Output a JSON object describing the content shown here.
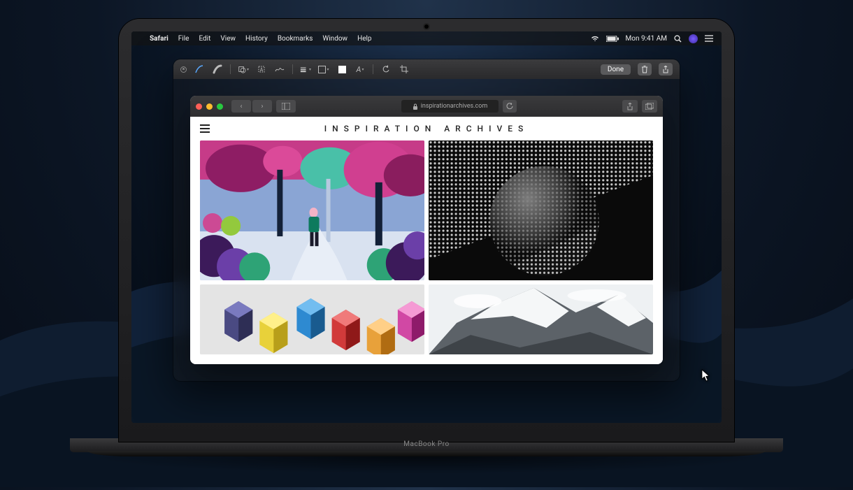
{
  "menubar": {
    "app": "Safari",
    "items": [
      "File",
      "Edit",
      "View",
      "History",
      "Bookmarks",
      "Window",
      "Help"
    ],
    "clock": "Mon 9:41 AM"
  },
  "markup": {
    "done": "Done"
  },
  "safari": {
    "url": "inspirationarchives.com"
  },
  "page": {
    "title": "INSPIRATION ARCHIVES"
  },
  "device": {
    "label": "MacBook Pro"
  }
}
